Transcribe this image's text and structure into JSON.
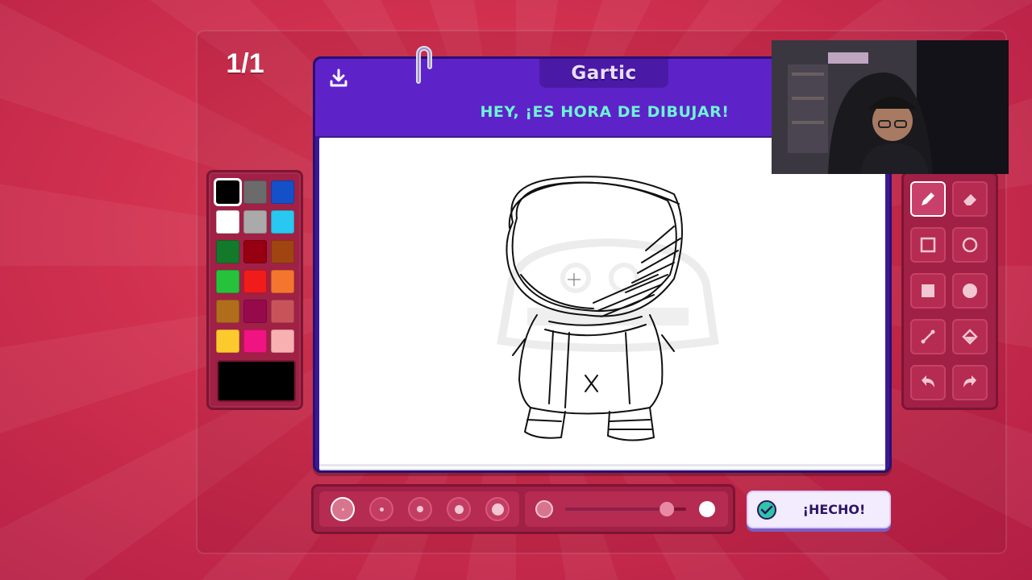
{
  "round_counter": "1/1",
  "header": {
    "logo": "Gartic",
    "title": "HEY, ¡ES HORA DE DIBUJAR!"
  },
  "palette": {
    "colors": [
      "#000000",
      "#6b6b6b",
      "#1450c8",
      "#ffffff",
      "#aaaaaa",
      "#28c8f0",
      "#127a2a",
      "#960010",
      "#a04412",
      "#26c23c",
      "#f01c1c",
      "#f4762e",
      "#b06e1c",
      "#960a4c",
      "#c8545a",
      "#fcca2c",
      "#f01482",
      "#f8b0b0"
    ],
    "selected_index": 0,
    "current_color": "#000000"
  },
  "tools": [
    {
      "name": "pencil",
      "active": true
    },
    {
      "name": "eraser",
      "active": false
    },
    {
      "name": "rectangle-outline",
      "active": false
    },
    {
      "name": "ellipse-outline",
      "active": false
    },
    {
      "name": "rectangle-filled",
      "active": false
    },
    {
      "name": "ellipse-filled",
      "active": false
    },
    {
      "name": "line",
      "active": false
    },
    {
      "name": "fill-bucket",
      "active": false
    },
    {
      "name": "undo",
      "active": false
    },
    {
      "name": "redo",
      "active": false
    }
  ],
  "brush_sizes": {
    "count": 5,
    "selected_index": 0
  },
  "opacity": {
    "value": 0.85
  },
  "done_button": {
    "label": "¡HECHO!"
  }
}
